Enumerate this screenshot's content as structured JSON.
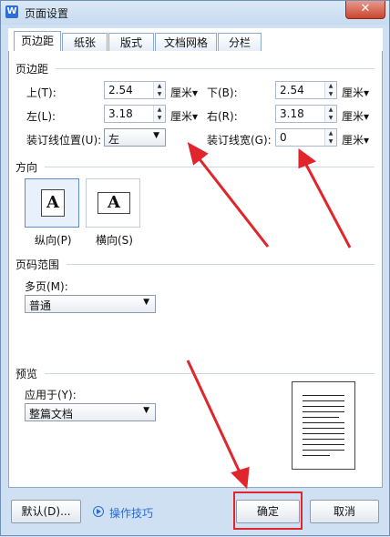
{
  "window": {
    "title": "页面设置",
    "close_symbol": "✕"
  },
  "tabs": [
    {
      "label": "页边距",
      "active": true
    },
    {
      "label": "纸张",
      "active": false
    },
    {
      "label": "版式",
      "active": false
    },
    {
      "label": "文档网格",
      "active": false
    },
    {
      "label": "分栏",
      "active": false
    }
  ],
  "margins": {
    "section_title": "页边距",
    "top": {
      "label": "上(T):",
      "value": "2.54",
      "unit": "厘米▾"
    },
    "bottom": {
      "label": "下(B):",
      "value": "2.54",
      "unit": "厘米▾"
    },
    "left": {
      "label": "左(L):",
      "value": "3.18",
      "unit": "厘米▾"
    },
    "right": {
      "label": "右(R):",
      "value": "3.18",
      "unit": "厘米▾"
    },
    "gutter_position": {
      "label": "装订线位置(U):",
      "value": "左"
    },
    "gutter_width": {
      "label": "装订线宽(G):",
      "value": "0",
      "unit": "厘米▾"
    }
  },
  "orientation": {
    "section_title": "方向",
    "portrait": {
      "label": "纵向(P)",
      "glyph": "A",
      "selected": true
    },
    "landscape": {
      "label": "横向(S)",
      "glyph": "A",
      "selected": false
    }
  },
  "page_range": {
    "section_title": "页码范围",
    "multiple_pages": {
      "label": "多页(M):",
      "value": "普通"
    }
  },
  "preview": {
    "section_title": "预览",
    "apply_to": {
      "label": "应用于(Y):",
      "value": "整篇文档"
    }
  },
  "buttons": {
    "default": "默认(D)...",
    "tips": "操作技巧",
    "ok": "确定",
    "cancel": "取消"
  },
  "colors": {
    "accent": "#2a6bd1",
    "annotation": "#e0262c",
    "window": "#cfe0f2"
  }
}
